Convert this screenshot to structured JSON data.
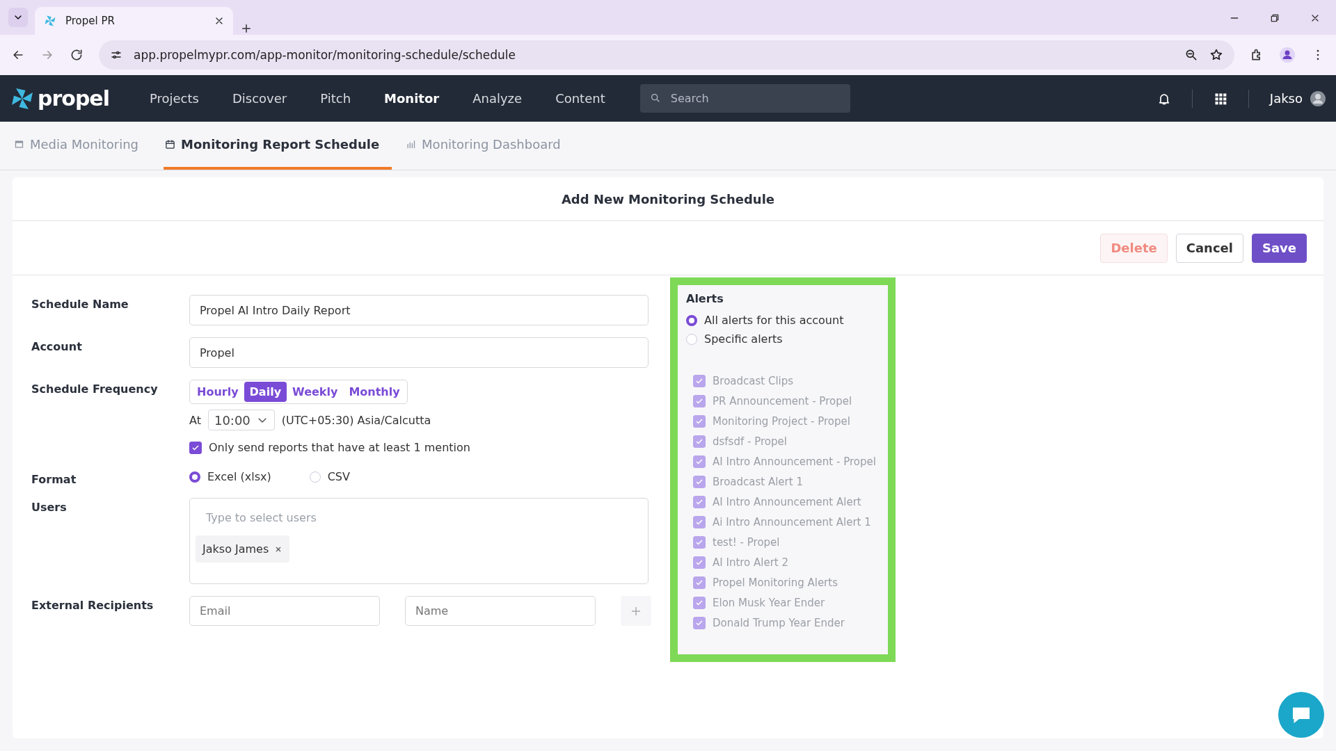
{
  "browser": {
    "tabs": [
      {
        "title": "Propel PR",
        "selected": true
      }
    ],
    "url": "app.propelmypr.com/app-monitor/monitoring-schedule/schedule"
  },
  "nav": {
    "logo": "propel",
    "items": [
      {
        "label": "Projects",
        "selected": false
      },
      {
        "label": "Discover",
        "selected": false
      },
      {
        "label": "Pitch",
        "selected": false
      },
      {
        "label": "Monitor",
        "selected": true
      },
      {
        "label": "Analyze",
        "selected": false
      },
      {
        "label": "Content",
        "selected": false
      }
    ],
    "search_placeholder": "Search",
    "user": "Jakso"
  },
  "subtabs": [
    {
      "label": "Media Monitoring",
      "selected": false,
      "kind": "window"
    },
    {
      "label": "Monitoring Report Schedule",
      "selected": true,
      "kind": "calendar"
    },
    {
      "label": "Monitoring Dashboard",
      "selected": false,
      "kind": "chart"
    }
  ],
  "card": {
    "title": "Add New Monitoring Schedule",
    "actions": [
      {
        "label": "Delete",
        "kind": "delete"
      },
      {
        "label": "Cancel",
        "kind": "cancel"
      },
      {
        "label": "Save",
        "kind": "save"
      }
    ]
  },
  "form": {
    "schedule_name": {
      "label": "Schedule Name",
      "value": "Propel AI Intro Daily Report"
    },
    "account": {
      "label": "Account",
      "value": "Propel"
    },
    "frequency": {
      "label": "Schedule Frequency",
      "options": [
        {
          "label": "Hourly",
          "selected": false
        },
        {
          "label": "Daily",
          "selected": true
        },
        {
          "label": "Weekly",
          "selected": false
        },
        {
          "label": "Monthly",
          "selected": false
        }
      ],
      "at_label": "At",
      "time": "10:00",
      "timezone": "(UTC+05:30) Asia/Calcutta"
    },
    "mention_filter": {
      "label": "Only send reports that have at least 1 mention",
      "checked": true
    },
    "format": {
      "label": "Format",
      "options": [
        {
          "label": "Excel (xlsx)",
          "selected": true
        },
        {
          "label": "CSV",
          "selected": false
        }
      ]
    },
    "users": {
      "label": "Users",
      "placeholder": "Type to select users",
      "chips": [
        {
          "label": "Jakso James"
        }
      ]
    },
    "external": {
      "label": "External Recipients",
      "email_placeholder": "Email",
      "name_placeholder": "Name"
    }
  },
  "alerts": {
    "title": "Alerts",
    "scope": [
      {
        "label": "All alerts for this account",
        "selected": true
      },
      {
        "label": "Specific alerts",
        "selected": false
      }
    ],
    "items": [
      {
        "label": "Broadcast Clips",
        "checked": true,
        "disabled": true
      },
      {
        "label": "PR Announcement - Propel",
        "checked": true,
        "disabled": true
      },
      {
        "label": "Monitoring Project - Propel",
        "checked": true,
        "disabled": true
      },
      {
        "label": "dsfsdf - Propel",
        "checked": true,
        "disabled": true
      },
      {
        "label": "AI Intro Announcement - Propel",
        "checked": true,
        "disabled": true
      },
      {
        "label": "Broadcast Alert 1",
        "checked": true,
        "disabled": true
      },
      {
        "label": "AI Intro Announcement Alert",
        "checked": true,
        "disabled": true
      },
      {
        "label": "Ai Intro Announcement Alert 1",
        "checked": true,
        "disabled": true
      },
      {
        "label": "test! - Propel",
        "checked": true,
        "disabled": true
      },
      {
        "label": "AI Intro Alert 2",
        "checked": true,
        "disabled": true
      },
      {
        "label": "Propel Monitoring Alerts",
        "checked": true,
        "disabled": true
      },
      {
        "label": "Elon Musk Year Ender",
        "checked": true,
        "disabled": true
      },
      {
        "label": "Donald Trump Year Ender",
        "checked": true,
        "disabled": true
      }
    ]
  }
}
